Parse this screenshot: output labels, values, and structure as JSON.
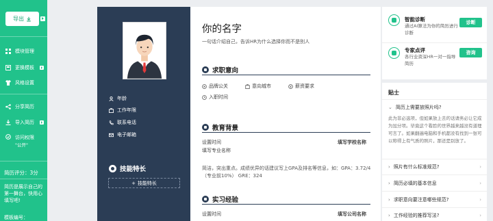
{
  "sidebar": {
    "export_label": "导出",
    "items": [
      {
        "label": "模块管理",
        "icon": "grid-icon"
      },
      {
        "label": "更换模板",
        "icon": "template-icon"
      },
      {
        "label": "风格设置",
        "icon": "shirt-icon"
      },
      {
        "label": "分享简历",
        "icon": "share-icon"
      },
      {
        "label": "导入简历",
        "icon": "import-icon"
      },
      {
        "label": "访问权限",
        "sub": "\"公开\"",
        "icon": "lock-icon"
      }
    ],
    "score_label": "简历评分：3分",
    "score_desc": "简历是展示自己的第一舞台，快用心填写吧!",
    "template_no_label": "模板编号："
  },
  "resume": {
    "name": "你的名字",
    "tagline": "一句话介绍自己，告诉HR为什么选择你而不是别人",
    "info": [
      "年龄",
      "工作年限",
      "联系电话",
      "电子邮箱"
    ],
    "skills_title": "技能特长",
    "skills_add": "技能特长",
    "sections": {
      "intent": {
        "title": "求职意向",
        "fields": [
          "品牌公关",
          "意向城市",
          "薪资要求",
          "入职时间"
        ]
      },
      "education": {
        "title": "教育背景",
        "time": "设置时间",
        "school": "填写学校名称",
        "major": "填写专业名称",
        "desc": "简洁，突出重点。成绩优异的话建议写上GPA及排名等信息，如：GPA：3.72/4（专业前10%） GRE：324"
      },
      "experience": {
        "title": "实习经验",
        "time": "设置时间",
        "company": "填写公司名称"
      }
    }
  },
  "right_panel": {
    "ai": {
      "title": "智能诊断",
      "desc": "通过AI算法为你的简历进行诊断",
      "button": "诊断"
    },
    "expert": {
      "title": "专家点评",
      "desc": "各行业资深HR一对一指导简历",
      "button": "咨询"
    }
  },
  "tips": {
    "title": "贴士",
    "items": [
      {
        "label": "简历上需要放照片吗?",
        "expanded": true
      },
      {
        "label": "照片有什么标准规范?"
      },
      {
        "label": "简历必填的基本信息"
      },
      {
        "label": "求职意向要注意哪些规范?"
      },
      {
        "label": "工作经验的推荐写法?"
      }
    ],
    "expanded_body": "此为非必选项，但如果放上去的话请务必让它成为加分项。毕竟这个看脸的世界越来越没有道理可言了。如果翻遍电脑和手机都没有找到一张可以称得上有气质的照片，那还是别放了。"
  },
  "colors": {
    "accent": "#21c28b",
    "resume_dark": "#2b3d55"
  }
}
